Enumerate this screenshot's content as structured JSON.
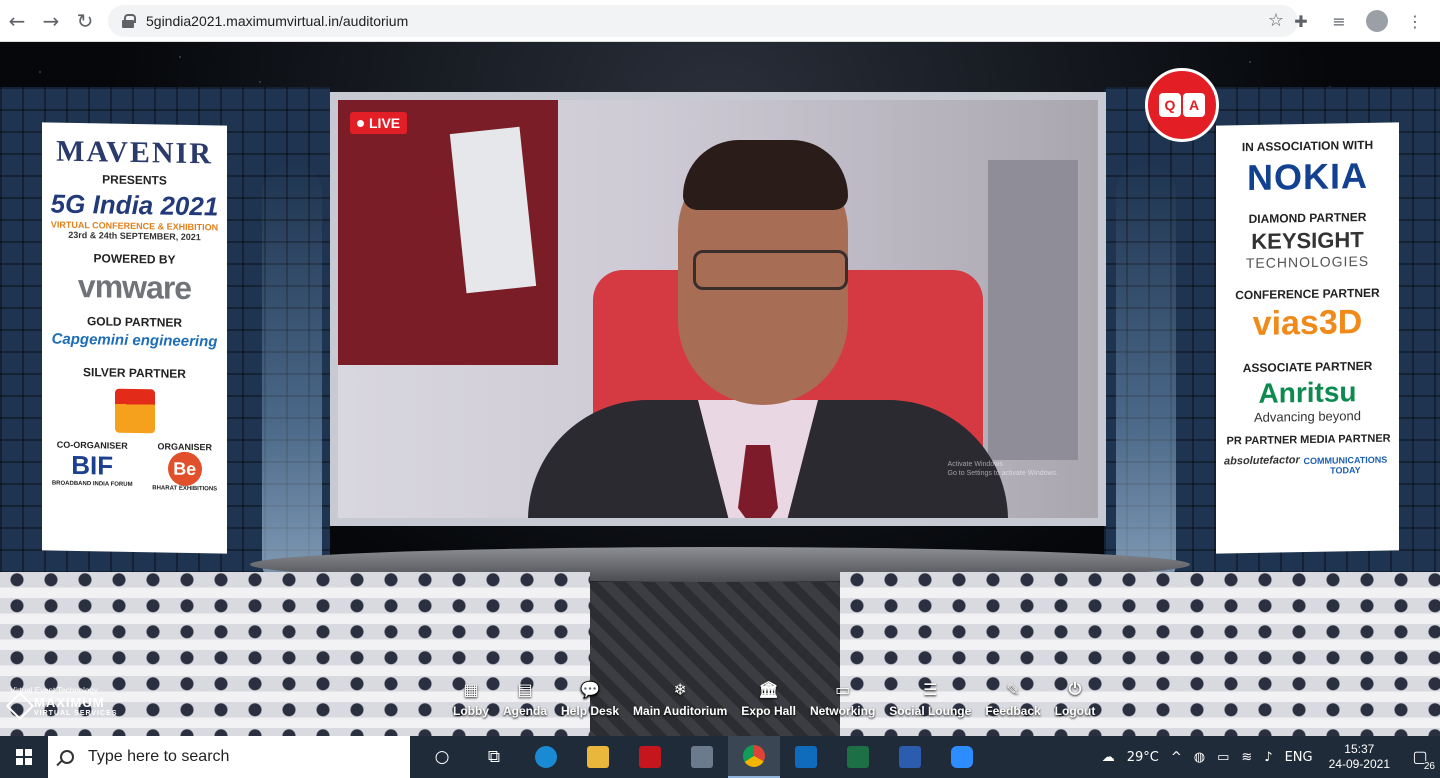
{
  "browser": {
    "url": "5gindia2021.maximumvirtual.in/auditorium",
    "nav": {
      "back": "←",
      "forward": "→",
      "reload": "↻"
    },
    "icons": {
      "star": "☆",
      "extensions": "✚",
      "media": "≡",
      "menu": "⋮"
    }
  },
  "video": {
    "live_label": "LIVE",
    "watermark_line1": "Activate Windows",
    "watermark_line2": "Go to Settings to activate Windows."
  },
  "qa_button": {
    "left": "Q",
    "right": "A"
  },
  "left_banner": {
    "brand": "MAVENIR",
    "presents": "PRESENTS",
    "event": "5G India 2021",
    "event_sub": "VIRTUAL CONFERENCE & EXHIBITION",
    "dates": "23rd & 24th SEPTEMBER, 2021",
    "powered_by": "POWERED BY",
    "powered_brand": "vmware",
    "gold_label": "GOLD PARTNER",
    "gold_brand": "Capgemini engineering",
    "silver_label": "SILVER PARTNER",
    "coorg_label": "CO-ORGANISER",
    "coorg_brand": "BIF",
    "coorg_sub": "BROADBAND INDIA FORUM",
    "org_label": "ORGANISER",
    "org_brand": "Be",
    "org_sub": "BHARAT EXHIBITIONS"
  },
  "right_banner": {
    "assoc_label": "IN ASSOCIATION WITH",
    "assoc_brand": "NOKIA",
    "diamond_label": "DIAMOND PARTNER",
    "diamond_brand": "KEYSIGHT",
    "diamond_sub": "TECHNOLOGIES",
    "conf_label": "CONFERENCE PARTNER",
    "conf_brand": "vias3D",
    "assoc2_label": "ASSOCIATE PARTNER",
    "assoc2_brand": "Anritsu",
    "assoc2_sub": "Advancing beyond",
    "pr_label": "PR PARTNER",
    "pr_brand": "absolutefactor",
    "media_label": "MEDIA PARTNER",
    "media_brand": "COMMUNICATIONS TODAY"
  },
  "menu": [
    {
      "label": "Lobby",
      "icon": "▦"
    },
    {
      "label": "Agenda",
      "icon": "▤"
    },
    {
      "label": "Help Desk",
      "icon": "💬"
    },
    {
      "label": "Main Auditorium",
      "icon": "❄"
    },
    {
      "label": "Expo Hall",
      "icon": "🏛"
    },
    {
      "label": "Networking",
      "icon": "▭"
    },
    {
      "label": "Social Lounge",
      "icon": "☰"
    },
    {
      "label": "Feedback",
      "icon": "✎"
    },
    {
      "label": "Logout",
      "icon": "⏻"
    }
  ],
  "vendor": {
    "tag": "Virtual Event Technology",
    "name": "MAXIMUM",
    "sub": "VIRTUAL SERVICES"
  },
  "taskbar": {
    "search_placeholder": "Type here to search",
    "weather": "29°C",
    "language": "ENG",
    "time": "15:37",
    "date": "24-09-2021",
    "notifications": "26"
  }
}
